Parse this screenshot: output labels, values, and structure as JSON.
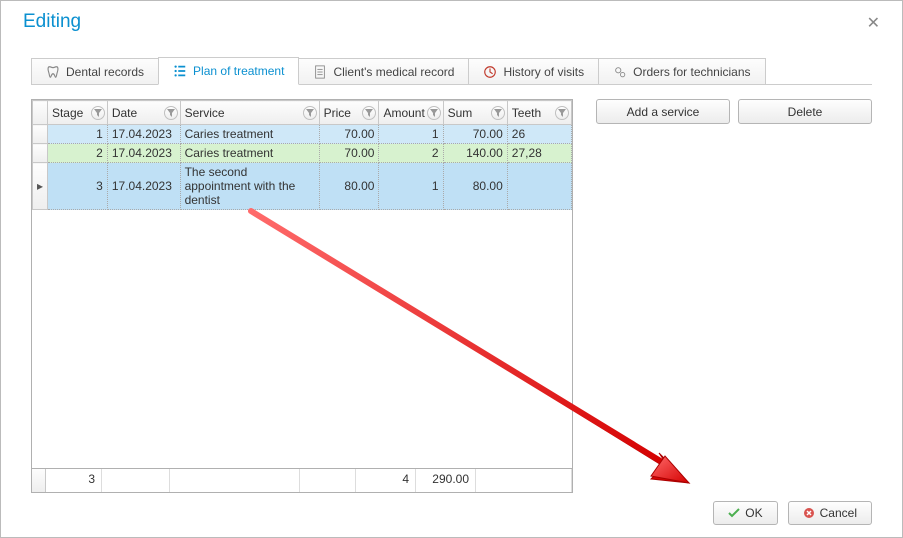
{
  "window": {
    "title": "Editing"
  },
  "tabs": [
    {
      "label": "Dental records"
    },
    {
      "label": "Plan of treatment"
    },
    {
      "label": "Client's medical record"
    },
    {
      "label": "History of visits"
    },
    {
      "label": "Orders for technicians"
    }
  ],
  "columns": {
    "stage": "Stage",
    "date": "Date",
    "service": "Service",
    "price": "Price",
    "amount": "Amount",
    "sum": "Sum",
    "teeth": "Teeth"
  },
  "rows": [
    {
      "stage": "1",
      "date": "17.04.2023",
      "service": "Caries treatment",
      "price": "70.00",
      "amount": "1",
      "sum": "70.00",
      "teeth": "26"
    },
    {
      "stage": "2",
      "date": "17.04.2023",
      "service": "Caries treatment",
      "price": "70.00",
      "amount": "2",
      "sum": "140.00",
      "teeth": "27,28"
    },
    {
      "stage": "3",
      "date": "17.04.2023",
      "service": "The second appointment with the dentist",
      "price": "80.00",
      "amount": "1",
      "sum": "80.00",
      "teeth": ""
    }
  ],
  "totals": {
    "stage_count": "3",
    "amount_total": "4",
    "sum_total": "290.00"
  },
  "buttons": {
    "add_service": "Add a service",
    "delete": "Delete",
    "ok": "OK",
    "cancel": "Cancel"
  }
}
